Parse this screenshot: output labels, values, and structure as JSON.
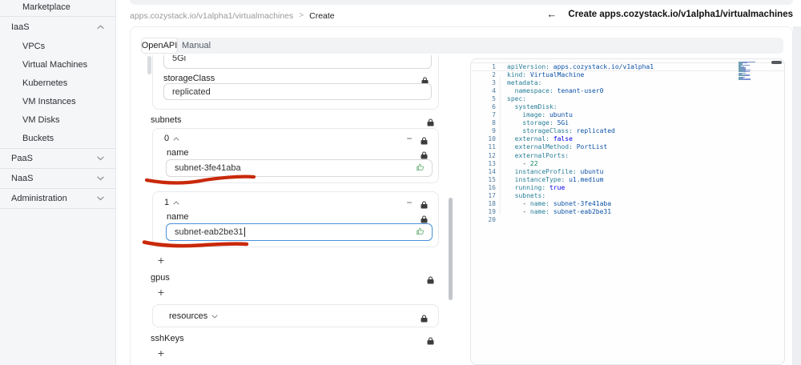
{
  "sidebar": {
    "items": [
      {
        "label": "Marketplace"
      },
      {
        "label": "IaaS",
        "state": "expanded"
      },
      {
        "label": "VPCs"
      },
      {
        "label": "Virtual Machines"
      },
      {
        "label": "Kubernetes"
      },
      {
        "label": "VM Instances"
      },
      {
        "label": "VM Disks"
      },
      {
        "label": "Buckets"
      },
      {
        "label": "PaaS",
        "state": "collapsed"
      },
      {
        "label": "NaaS",
        "state": "collapsed"
      },
      {
        "label": "Administration",
        "state": "collapsed"
      }
    ]
  },
  "breadcrumb": {
    "path": "apps.cozystack.io/v1alpha1/virtualmachines",
    "separator": ">",
    "current": "Create"
  },
  "header": {
    "back_arrow": "←",
    "title": "Create apps.cozystack.io/v1alpha1/virtualmachines"
  },
  "tabs": {
    "openapi": "OpenAPI",
    "manual": "Manual"
  },
  "form": {
    "partial_field_value": "5Gi",
    "storage_class_label": "storageClass",
    "storage_class_value": "replicated",
    "subnets_label": "subnets",
    "item0_index": "0",
    "item1_index": "1",
    "name_label": "name",
    "subnet0_value": "subnet-3fe41aba",
    "subnet1_value": "subnet-eab2be31",
    "gpus_label": "gpus",
    "resources_label": "resources",
    "ssh_keys_label": "sshKeys",
    "add_button_label": "+",
    "remove_button_label": "−"
  },
  "editor": {
    "lines": [
      {
        "n": "1",
        "tokens": [
          [
            "key",
            "apiVersion:"
          ],
          [
            "val",
            " apps.cozystack.io/v1alpha1"
          ]
        ]
      },
      {
        "n": "2",
        "tokens": [
          [
            "key",
            "kind:"
          ],
          [
            "val",
            " VirtualMachine"
          ]
        ]
      },
      {
        "n": "3",
        "tokens": [
          [
            "key",
            "metadata:"
          ]
        ]
      },
      {
        "n": "4",
        "tokens": [
          [
            "plain",
            "  "
          ],
          [
            "key",
            "namespace:"
          ],
          [
            "val",
            " tenant-user0"
          ]
        ]
      },
      {
        "n": "5",
        "tokens": [
          [
            "key",
            "spec:"
          ]
        ]
      },
      {
        "n": "6",
        "tokens": [
          [
            "plain",
            "  "
          ],
          [
            "key",
            "systemDisk:"
          ]
        ]
      },
      {
        "n": "7",
        "tokens": [
          [
            "plain",
            "    "
          ],
          [
            "key",
            "image:"
          ],
          [
            "val",
            " ubuntu"
          ]
        ]
      },
      {
        "n": "8",
        "tokens": [
          [
            "plain",
            "    "
          ],
          [
            "key",
            "storage:"
          ],
          [
            "val",
            " 5Gi"
          ]
        ]
      },
      {
        "n": "9",
        "tokens": [
          [
            "plain",
            "    "
          ],
          [
            "key",
            "storageClass:"
          ],
          [
            "val",
            " replicated"
          ]
        ]
      },
      {
        "n": "10",
        "tokens": [
          [
            "plain",
            "  "
          ],
          [
            "key",
            "external:"
          ],
          [
            "bool",
            " false"
          ]
        ]
      },
      {
        "n": "11",
        "tokens": [
          [
            "plain",
            "  "
          ],
          [
            "key",
            "externalMethod:"
          ],
          [
            "val",
            " PortList"
          ]
        ]
      },
      {
        "n": "12",
        "tokens": [
          [
            "plain",
            "  "
          ],
          [
            "key",
            "externalPorts:"
          ]
        ]
      },
      {
        "n": "13",
        "tokens": [
          [
            "plain",
            "    - "
          ],
          [
            "num",
            "22"
          ]
        ]
      },
      {
        "n": "14",
        "tokens": [
          [
            "plain",
            "  "
          ],
          [
            "key",
            "instanceProfile:"
          ],
          [
            "val",
            " ubuntu"
          ]
        ]
      },
      {
        "n": "15",
        "tokens": [
          [
            "plain",
            "  "
          ],
          [
            "key",
            "instanceType:"
          ],
          [
            "val",
            " u1.medium"
          ]
        ]
      },
      {
        "n": "16",
        "tokens": [
          [
            "plain",
            "  "
          ],
          [
            "key",
            "running:"
          ],
          [
            "bool",
            " true"
          ]
        ]
      },
      {
        "n": "17",
        "tokens": [
          [
            "plain",
            "  "
          ],
          [
            "key",
            "subnets:"
          ]
        ]
      },
      {
        "n": "18",
        "tokens": [
          [
            "plain",
            "    - "
          ],
          [
            "key",
            "name:"
          ],
          [
            "val",
            " subnet-3fe41aba"
          ]
        ]
      },
      {
        "n": "19",
        "tokens": [
          [
            "plain",
            "    - "
          ],
          [
            "key",
            "name:"
          ],
          [
            "val",
            " subnet-eab2be31"
          ]
        ]
      },
      {
        "n": "20",
        "tokens": []
      }
    ]
  },
  "colors": {
    "focus_blue": "#4a90d9",
    "valid_green": "#78b885",
    "annotation_red": "#c9290a",
    "yaml_key": "#267f99",
    "yaml_value": "#0a51a8",
    "yaml_bool": "#0000ee",
    "yaml_number": "#098658"
  }
}
